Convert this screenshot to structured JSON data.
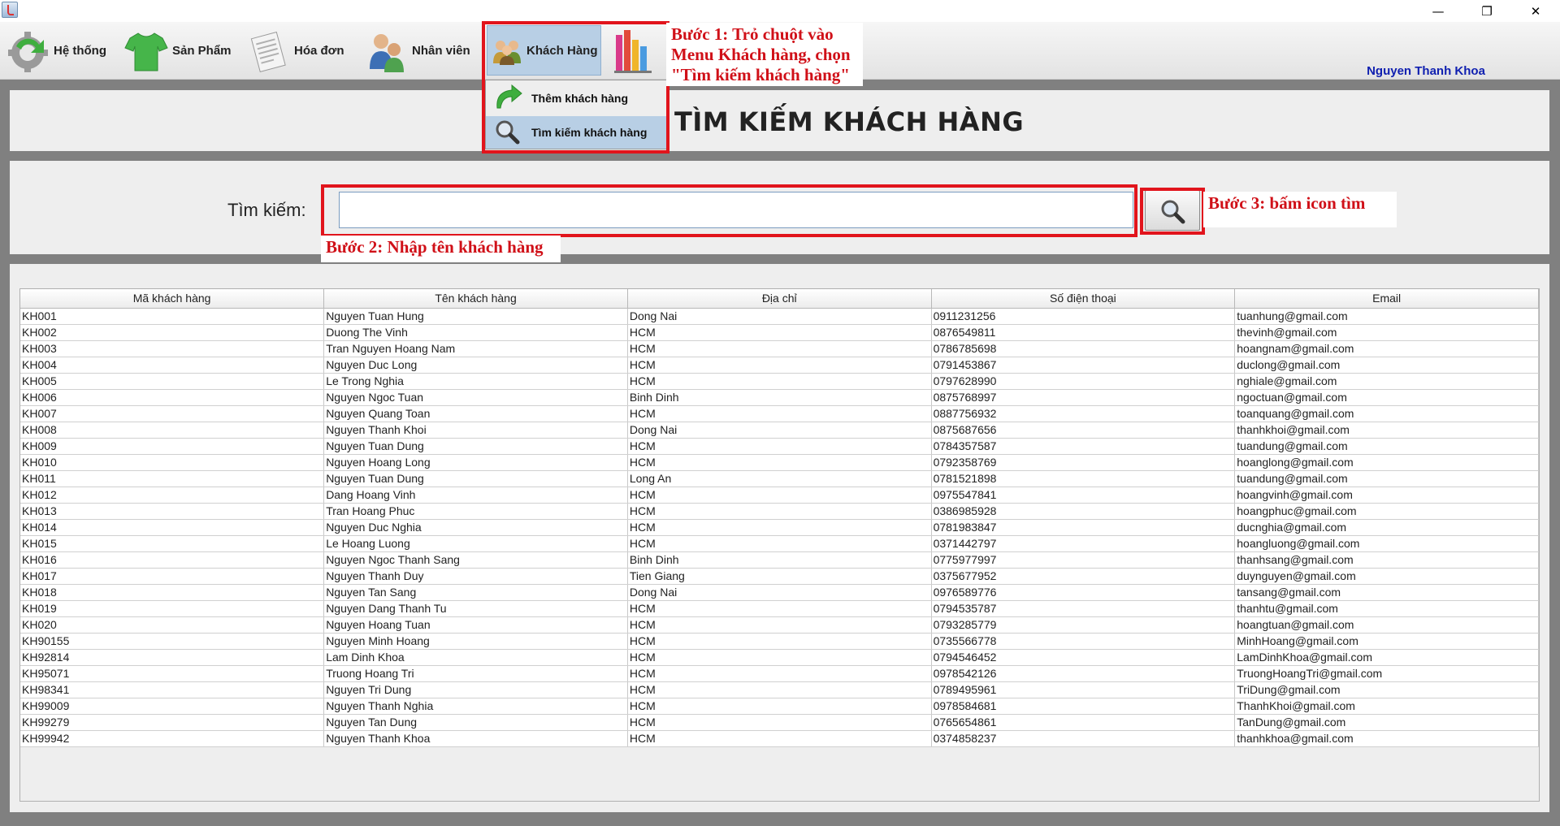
{
  "window": {
    "minimize": "—",
    "maximize": "❐",
    "close": "✕"
  },
  "menubar": {
    "items": [
      {
        "label": "Hệ thống",
        "icon": "gear-refresh-icon"
      },
      {
        "label": "Sản Phẩm",
        "icon": "tshirt-icon"
      },
      {
        "label": "Hóa đơn",
        "icon": "invoice-icon"
      },
      {
        "label": "Nhân viên",
        "icon": "staff-icon"
      },
      {
        "label": "Khách Hàng",
        "icon": "customers-icon"
      },
      {
        "label": "",
        "icon": "bar-chart-icon"
      }
    ],
    "user": "Nguyen Thanh Khoa"
  },
  "dropdown": {
    "items": [
      {
        "label": "Thêm khách hàng",
        "icon": "add-arrow-icon"
      },
      {
        "label": "Tìm kiếm khách hàng",
        "icon": "magnifier-icon"
      }
    ]
  },
  "header": {
    "title": "TÌM KIẾM KHÁCH HÀNG"
  },
  "search": {
    "label": "Tìm kiếm:",
    "value": "",
    "button_icon": "search-icon"
  },
  "annotations": {
    "step1": "Bước 1: Trỏ chuột vào Menu Khách hàng, chọn \"Tìm kiếm khách hàng\"",
    "step2": "Bước 2: Nhập tên khách hàng",
    "step3": "Bước 3: bấm icon tìm",
    "highlight_color": "#e1141c"
  },
  "table": {
    "columns": [
      "Mã khách hàng",
      "Tên khách hàng",
      "Địa chỉ",
      "Số điện thoại",
      "Email"
    ],
    "rows": [
      [
        "KH001",
        "Nguyen Tuan Hung",
        "Dong Nai",
        "0911231256",
        "tuanhung@gmail.com"
      ],
      [
        "KH002",
        "Duong The Vinh",
        "HCM",
        "0876549811",
        "thevinh@gmail.com"
      ],
      [
        "KH003",
        "Tran Nguyen Hoang Nam",
        "HCM",
        "0786785698",
        "hoangnam@gmail.com"
      ],
      [
        "KH004",
        "Nguyen Duc Long",
        "HCM",
        "0791453867",
        "duclong@gmail.com"
      ],
      [
        "KH005",
        "Le Trong Nghia",
        "HCM",
        "0797628990",
        "nghiale@gmail.com"
      ],
      [
        "KH006",
        "Nguyen Ngoc Tuan",
        "Binh Dinh",
        "0875768997",
        "ngoctuan@gmail.com"
      ],
      [
        "KH007",
        "Nguyen Quang Toan",
        "HCM",
        "0887756932",
        "toanquang@gmail.com"
      ],
      [
        "KH008",
        "Nguyen Thanh Khoi",
        "Dong Nai",
        "0875687656",
        "thanhkhoi@gmail.com"
      ],
      [
        "KH009",
        "Nguyen Tuan Dung",
        "HCM",
        "0784357587",
        "tuandung@gmail.com"
      ],
      [
        "KH010",
        "Nguyen Hoang Long",
        "HCM",
        "0792358769",
        "hoanglong@gmail.com"
      ],
      [
        "KH011",
        "Nguyen Tuan Dung",
        "Long An",
        "0781521898",
        "tuandung@gmail.com"
      ],
      [
        "KH012",
        "Dang Hoang Vinh",
        "HCM",
        "0975547841",
        "hoangvinh@gmail.com"
      ],
      [
        "KH013",
        "Tran Hoang Phuc",
        "HCM",
        "0386985928",
        "hoangphuc@gmail.com"
      ],
      [
        "KH014",
        "Nguyen Duc Nghia",
        "HCM",
        "0781983847",
        "ducnghia@gmail.com"
      ],
      [
        "KH015",
        "Le Hoang Luong",
        "HCM",
        "0371442797",
        "hoangluong@gmail.com"
      ],
      [
        "KH016",
        "Nguyen Ngoc Thanh Sang",
        "Binh Dinh",
        "0775977997",
        "thanhsang@gmail.com"
      ],
      [
        "KH017",
        "Nguyen Thanh Duy",
        "Tien Giang",
        "0375677952",
        "duynguyen@gmail.com"
      ],
      [
        "KH018",
        "Nguyen Tan Sang",
        "Dong Nai",
        "0976589776",
        "tansang@gmail.com"
      ],
      [
        "KH019",
        "Nguyen Dang Thanh Tu",
        "HCM",
        "0794535787",
        "thanhtu@gmail.com"
      ],
      [
        "KH020",
        "Nguyen Hoang Tuan",
        "HCM",
        "0793285779",
        "hoangtuan@gmail.com"
      ],
      [
        "KH90155",
        "Nguyen Minh Hoang",
        "HCM",
        "0735566778",
        "MinhHoang@gmail.com"
      ],
      [
        "KH92814",
        "Lam Dinh Khoa",
        "HCM",
        "0794546452",
        "LamDinhKhoa@gmail.com"
      ],
      [
        "KH95071",
        "Truong Hoang Tri",
        "HCM",
        "0978542126",
        "TruongHoangTri@gmail.com"
      ],
      [
        "KH98341",
        "Nguyen Tri Dung",
        "HCM",
        "0789495961",
        "TriDung@gmail.com"
      ],
      [
        "KH99009",
        "Nguyen Thanh Nghia",
        "HCM",
        "0978584681",
        "ThanhKhoi@gmail.com"
      ],
      [
        "KH99279",
        "Nguyen Tan Dung",
        "HCM",
        "0765654861",
        "TanDung@gmail.com"
      ],
      [
        "KH99942",
        "Nguyen Thanh Khoa",
        "HCM",
        "0374858237",
        "thanhkhoa@gmail.com"
      ]
    ]
  }
}
